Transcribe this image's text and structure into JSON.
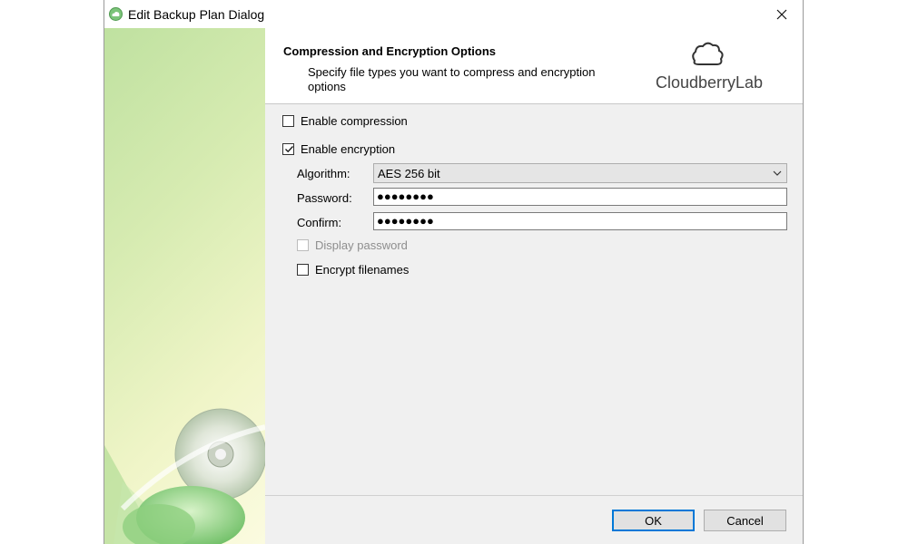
{
  "window": {
    "title": "Edit Backup Plan Dialog"
  },
  "header": {
    "title": "Compression and Encryption Options",
    "description": "Specify file types you want to compress and encryption options",
    "logo_text": "CloudberryLab"
  },
  "options": {
    "enable_compression": {
      "label": "Enable compression",
      "checked": false
    },
    "enable_encryption": {
      "label": "Enable encryption",
      "checked": true
    },
    "algorithm": {
      "label": "Algorithm:",
      "value": "AES 256 bit"
    },
    "password": {
      "label": "Password:",
      "value": "●●●●●●●●"
    },
    "confirm": {
      "label": "Confirm:",
      "value": "●●●●●●●●"
    },
    "display_password": {
      "label": "Display password",
      "checked": false,
      "enabled": false
    },
    "encrypt_filenames": {
      "label": "Encrypt filenames",
      "checked": false
    }
  },
  "buttons": {
    "ok": "OK",
    "cancel": "Cancel"
  },
  "colors": {
    "accent": "#0078d7",
    "sidebar_green": "#bfe1a0"
  },
  "icons": [
    "cloud-app-icon",
    "close-icon",
    "chevron-down-icon",
    "check-icon",
    "cloudberry-logo-icon",
    "disc-graphic"
  ]
}
